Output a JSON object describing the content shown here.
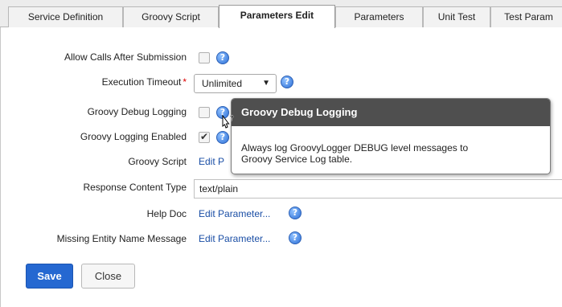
{
  "tabs": [
    {
      "label": "Service Definition"
    },
    {
      "label": "Groovy Script"
    },
    {
      "label": "Parameters Edit"
    },
    {
      "label": "Parameters"
    },
    {
      "label": "Unit Test"
    },
    {
      "label": "Test Param"
    }
  ],
  "active_tab": "Parameters Edit",
  "form": {
    "allow_calls": {
      "label": "Allow Calls After Submission",
      "checked": false
    },
    "execution_timeout": {
      "label": "Execution Timeout",
      "required_marker": "*",
      "value": "Unlimited",
      "arrow": "▼"
    },
    "groovy_debug": {
      "label": "Groovy Debug Logging",
      "checked": false
    },
    "groovy_logging": {
      "label": "Groovy Logging Enabled",
      "checked": true
    },
    "groovy_script": {
      "label": "Groovy Script",
      "link": "Edit P"
    },
    "response_content_type": {
      "label": "Response Content Type",
      "value": "text/plain"
    },
    "help_doc": {
      "label": "Help Doc",
      "link": "Edit Parameter..."
    },
    "missing_entity": {
      "label": "Missing Entity Name Message",
      "link": "Edit Parameter..."
    }
  },
  "help_glyph": "?",
  "buttons": {
    "save": "Save",
    "close": "Close"
  },
  "tooltip": {
    "title": "Groovy Debug Logging",
    "line1": "Always log GroovyLogger DEBUG level messages to",
    "line2": "Groovy Service Log table."
  },
  "colors": {
    "primary": "#2568d1",
    "link": "#1a4ea5",
    "tooltip_header": "#4f4f4f",
    "required": "#dd0000"
  },
  "icons": {
    "help": "help-icon",
    "cursor": "help-pointer-cursor",
    "dropdown": "chevron-down-icon"
  }
}
